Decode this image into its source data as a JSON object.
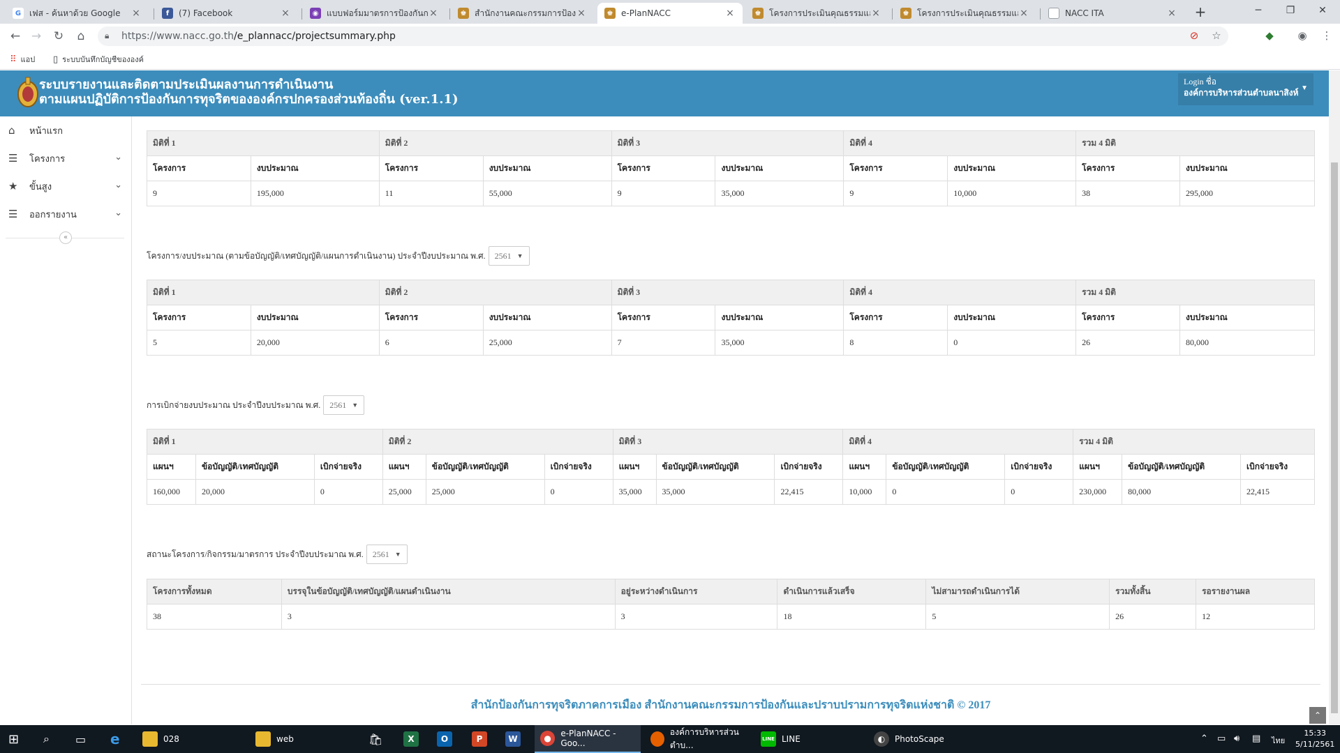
{
  "browser": {
    "tabs": [
      {
        "title": "เฟส - ค้นหาด้วย Google",
        "fav": "G",
        "color": "#4285f4"
      },
      {
        "title": "(7) Facebook",
        "fav": "f",
        "color": "#3b5998"
      },
      {
        "title": "แบบฟอร์มมาตรการป้องกันการทุ",
        "fav": "◉",
        "color": "#7b3fb5"
      },
      {
        "title": "สำนักงานคณะกรรมการป้องกันและ",
        "fav": "♚",
        "color": "#c08a2e"
      },
      {
        "title": "e-PlanNACC",
        "fav": "♚",
        "color": "#c08a2e"
      },
      {
        "title": "โครงการประเมินคุณธรรมและควา",
        "fav": "♚",
        "color": "#c08a2e"
      },
      {
        "title": "โครงการประเมินคุณธรรมและควา",
        "fav": "♚",
        "color": "#c08a2e"
      },
      {
        "title": "NACC ITA",
        "fav": "▯",
        "color": "#9aa0a6"
      }
    ],
    "url_prefix": "https://www.nacc.go.th",
    "url_path": "/e_plannacc/projectsummary.php",
    "bookmarks": [
      {
        "label": "แอป",
        "icon": "apps-grid-icon"
      },
      {
        "label": "ระบบบันทึกบัญชีขององค์",
        "icon": "page-icon"
      }
    ]
  },
  "header": {
    "title_line1": "ระบบรายงานและติดตามประเมินผลงานการดำเนินงาน",
    "title_line2": "ตามแผนปฏิบัติการป้องกันการทุจริตขององค์กรปกครองส่วนท้องถิ่น (ver.1.1)",
    "login_label": "Login ชื่อ",
    "login_name": "องค์การบริหารส่วนตำบลนาสิงห์"
  },
  "sidebar": {
    "items": [
      {
        "label": "หน้าแรก",
        "icon": "home-icon",
        "has_chevron": false
      },
      {
        "label": "โครงการ",
        "icon": "list-icon",
        "has_chevron": true
      },
      {
        "label": "ขั้นสูง",
        "icon": "star-icon",
        "has_chevron": true
      },
      {
        "label": "ออกรายงาน",
        "icon": "list-icon",
        "has_chevron": true
      }
    ]
  },
  "table1": {
    "groups": [
      "มิติที่ 1",
      "มิติที่ 2",
      "มิติที่ 3",
      "มิติที่ 4",
      "รวม 4 มิติ"
    ],
    "headers": [
      "โครงการ",
      "งบประมาณ",
      "โครงการ",
      "งบประมาณ",
      "โครงการ",
      "งบประมาณ",
      "โครงการ",
      "งบประมาณ",
      "โครงการ",
      "งบประมาณ"
    ],
    "row": [
      "9",
      "195,000",
      "11",
      "55,000",
      "9",
      "35,000",
      "9",
      "10,000",
      "38",
      "295,000"
    ]
  },
  "filter2": {
    "label": "โครงการ/งบประมาณ (ตามข้อบัญญัติ/เทศบัญญัติ/แผนการดำเนินงาน) ประจำปีงบประมาณ พ.ศ.",
    "year": "2561"
  },
  "table2": {
    "groups": [
      "มิติที่ 1",
      "มิติที่ 2",
      "มิติที่ 3",
      "มิติที่ 4",
      "รวม 4 มิติ"
    ],
    "headers": [
      "โครงการ",
      "งบประมาณ",
      "โครงการ",
      "งบประมาณ",
      "โครงการ",
      "งบประมาณ",
      "โครงการ",
      "งบประมาณ",
      "โครงการ",
      "งบประมาณ"
    ],
    "row": [
      "5",
      "20,000",
      "6",
      "25,000",
      "7",
      "35,000",
      "8",
      "0",
      "26",
      "80,000"
    ]
  },
  "filter3": {
    "label": "การเบิกจ่ายงบประมาณ ประจำปีงบประมาณ พ.ศ.",
    "year": "2561"
  },
  "table3": {
    "groups": [
      "มิติที่ 1",
      "มิติที่ 2",
      "มิติที่ 3",
      "มิติที่ 4",
      "รวม 4 มิติ"
    ],
    "headers": [
      "แผนฯ",
      "ข้อบัญญัติ/เทศบัญญัติ",
      "เบิกจ่ายจริง",
      "แผนฯ",
      "ข้อบัญญัติ/เทศบัญญัติ",
      "เบิกจ่ายจริง",
      "แผนฯ",
      "ข้อบัญญัติ/เทศบัญญัติ",
      "เบิกจ่ายจริง",
      "แผนฯ",
      "ข้อบัญญัติ/เทศบัญญัติ",
      "เบิกจ่ายจริง",
      "แผนฯ",
      "ข้อบัญญัติ/เทศบัญญัติ",
      "เบิกจ่ายจริง"
    ],
    "row": [
      "160,000",
      "20,000",
      "0",
      "25,000",
      "25,000",
      "0",
      "35,000",
      "35,000",
      "22,415",
      "10,000",
      "0",
      "0",
      "230,000",
      "80,000",
      "22,415"
    ]
  },
  "filter4": {
    "label": "สถานะโครงการ/กิจกรรม/มาตรการ ประจำปีงบประมาณ พ.ศ.",
    "year": "2561"
  },
  "table4": {
    "headers": [
      "โครงการทั้งหมด",
      "บรรจุในข้อบัญญัติ/เทศบัญญัติ/แผนดำเนินงาน",
      "อยู่ระหว่างดำเนินการ",
      "ดำเนินการแล้วเสร็จ",
      "ไม่สามารถดำเนินการได้",
      "รวมทั้งสิ้น",
      "รอรายงานผล"
    ],
    "row": [
      "38",
      "3",
      "3",
      "18",
      "5",
      "26",
      "12"
    ]
  },
  "footer": {
    "text": "สำนักป้องกันการทุจริตภาคการเมือง สำนักงานคณะกรรมการป้องกันและปราบปรามการทุจริตแห่งชาติ © 2017"
  },
  "taskbar": {
    "apps": [
      {
        "label": "028",
        "icon": "folder-icon",
        "color": "#e8b830"
      },
      {
        "label": "web",
        "icon": "folder-icon",
        "color": "#e8b830"
      },
      {
        "label": "e-PlanNACC - Goo...",
        "icon": "chrome-icon",
        "color": "#db4437"
      },
      {
        "label": "องค์การบริหารส่วนตำบ...",
        "icon": "firefox-icon",
        "color": "#e66000"
      },
      {
        "label": "LINE",
        "icon": "line-icon",
        "color": "#00b900"
      },
      {
        "label": "PhotoScape",
        "icon": "photoscape-icon",
        "color": "#444"
      }
    ],
    "lang": "ไทย",
    "time": "15:33",
    "date": "5/11/2561"
  }
}
